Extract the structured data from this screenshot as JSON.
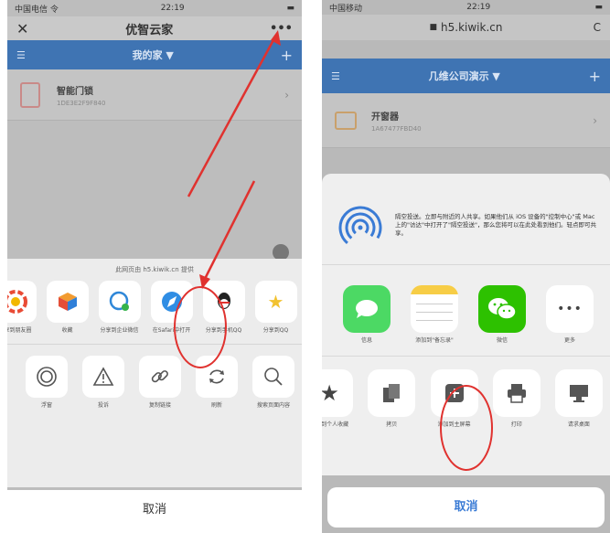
{
  "left": {
    "status": {
      "carrier": "中国电信 令",
      "time": "22:19"
    },
    "nav": {
      "close": "✕",
      "title": "优智云家",
      "more": "•••"
    },
    "bluebar": {
      "menu": "☰",
      "title": "我的家 ▼",
      "add": "+"
    },
    "device": {
      "name": "智能门锁",
      "id": "1DE3E2F9F840",
      "chevron": "›"
    },
    "sheet": {
      "title": "此网页由 h5.kiwik.cn 提供",
      "apps": [
        {
          "icon": "photos-icon",
          "label": "分享到朋友圈"
        },
        {
          "icon": "box-icon",
          "label": "收藏"
        },
        {
          "icon": "chat-icon",
          "label": "分享到企业微信"
        },
        {
          "icon": "safari-icon",
          "label": "在Safari中打开"
        },
        {
          "icon": "qq-icon",
          "label": "分享到手机QQ"
        },
        {
          "icon": "star-icon",
          "label": "分享到QQ"
        }
      ],
      "actions": [
        {
          "icon": "float-icon",
          "label": "浮窗"
        },
        {
          "icon": "warning-icon",
          "label": "投诉"
        },
        {
          "icon": "link-icon",
          "label": "复制链接"
        },
        {
          "icon": "refresh-icon",
          "label": "刷新"
        },
        {
          "icon": "search-icon",
          "label": "搜索页面内容"
        }
      ],
      "cancel": "取消"
    },
    "annotation_color": "#e0322f"
  },
  "right": {
    "status": {
      "carrier": "中国移动",
      "time": "22:19"
    },
    "url": "h5.kiwik.cn",
    "reload": "C",
    "bluebar": {
      "menu": "☰",
      "title": "几维公司演示 ▼",
      "add": "+"
    },
    "device": {
      "name": "开窗器",
      "id": "1A67477FBD40",
      "chevron": "›"
    },
    "airdrop": {
      "text": "隔空投送。立即与附近的人共享。如果他们从 iOS 设备的\"控制中心\"或 Mac 上的\"访达\"中打开了\"隔空投送\"，那么您将可以在此处看到他们。轻点即可共享。"
    },
    "apps": [
      {
        "icon": "messages-icon",
        "label": "信息"
      },
      {
        "icon": "notes-icon",
        "label": "添加到\"备忘录\""
      },
      {
        "icon": "wechat-icon",
        "label": "微信"
      },
      {
        "icon": "more-icon",
        "label": "更多"
      }
    ],
    "actions": [
      {
        "icon": "star-icon",
        "label": "添加到个人收藏"
      },
      {
        "icon": "copy-icon",
        "label": "拷贝"
      },
      {
        "icon": "add-home-icon",
        "label": "添加到主屏幕"
      },
      {
        "icon": "print-icon",
        "label": "打印"
      },
      {
        "icon": "desktop-icon",
        "label": "请求桌面"
      }
    ],
    "cancel": "取消",
    "accent": "#3a7bd5"
  }
}
